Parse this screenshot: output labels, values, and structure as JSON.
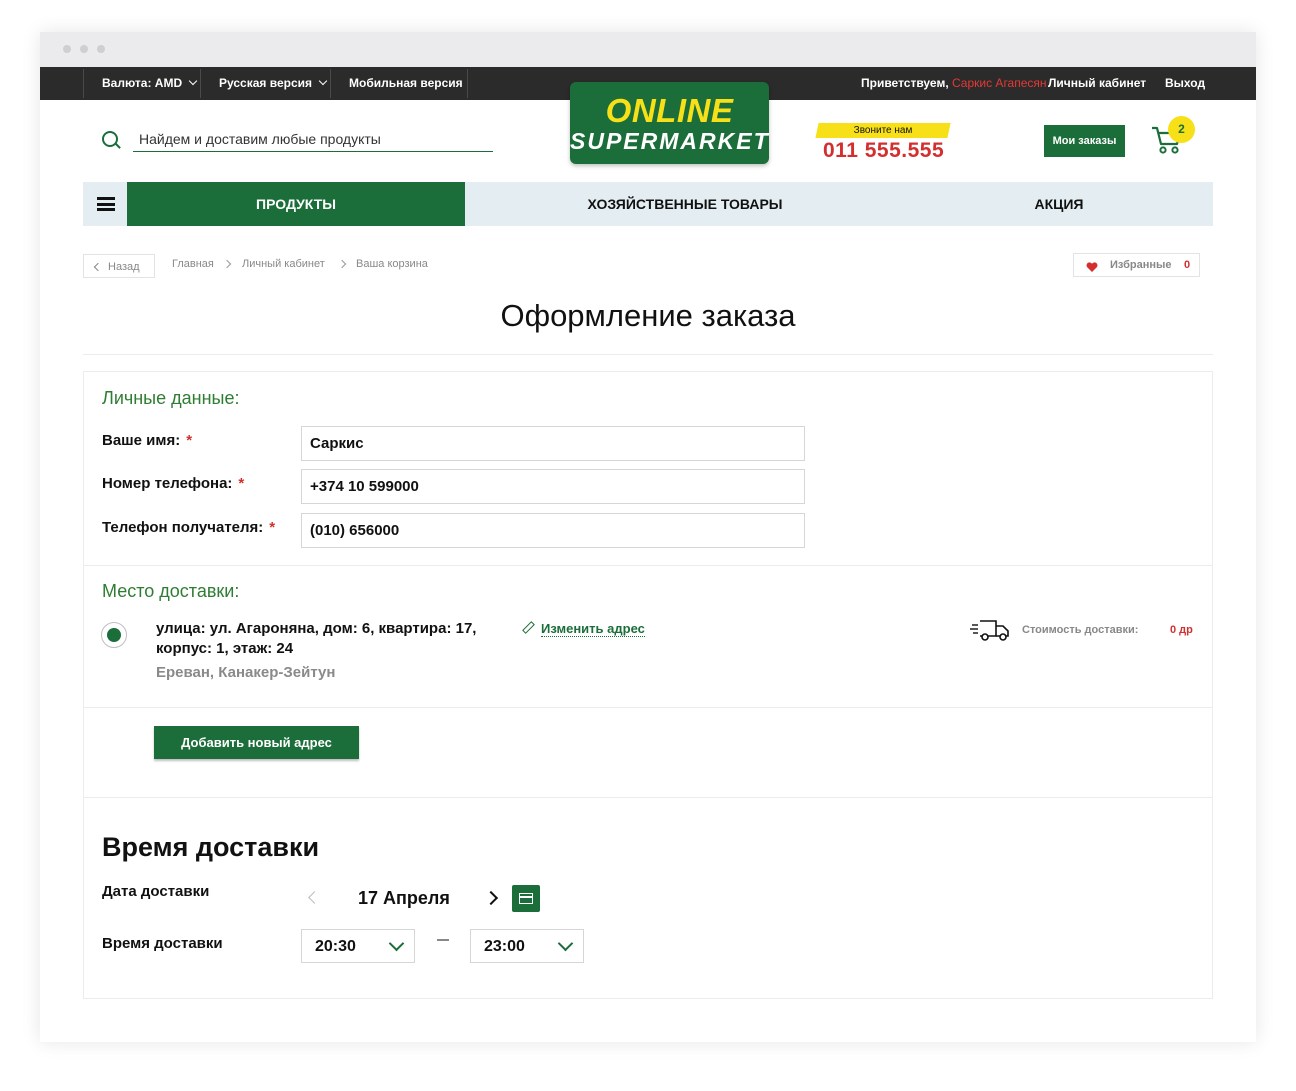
{
  "topbar": {
    "currency": "Валюта: AMD",
    "language": "Русская версия",
    "mobile": "Мобильная версия",
    "greeting": "Приветствуем,",
    "user_name": "Саркис Агапесян",
    "account": "Личный кабинет",
    "logout": "Выход"
  },
  "header": {
    "search_placeholder": "Найдем и доставим любые продукты",
    "logo_line1": "ONLINE",
    "logo_line2": "SUPERMARKET",
    "call_label": "Звоните нам",
    "phone": "011 555.555",
    "orders_label": "Мои заказы",
    "cart_count": "2"
  },
  "nav": {
    "items": [
      {
        "label": "ПРОДУКТЫ"
      },
      {
        "label": "ХОЗЯЙСТВЕННЫЕ ТОВАРЫ"
      },
      {
        "label": "АКЦИЯ"
      }
    ]
  },
  "breadcrumb": {
    "back": "Назад",
    "items": [
      "Главная",
      "Личный кабинет",
      "Ваша корзина"
    ]
  },
  "favorites": {
    "label": "Избранные",
    "count": "0"
  },
  "page_title": "Оформление заказа",
  "personal": {
    "title": "Личные данные:",
    "required_mark": "*",
    "fields": [
      {
        "label": "Ваше имя:",
        "value": "Саркис"
      },
      {
        "label": "Номер телефона:",
        "value": "+374 10 599000"
      },
      {
        "label": "Телефон получателя:",
        "value": "(010) 656000"
      }
    ]
  },
  "delivery_place": {
    "title": "Место доставки:",
    "address_line1": "улица: ул. Агароняна, дом: 6, квартира: 17,",
    "address_line2": "корпус: 1, этаж: 24",
    "city": "Ереван, Канакер-Зейтун",
    "edit_label": "Изменить адрес",
    "cost_label": "Стоимость доставки:",
    "cost_value": "0 др",
    "add_address": "Добавить новый адрес"
  },
  "delivery_time": {
    "title": "Время доставки",
    "date_label": "Дата доставки",
    "date_value": "17 Апреля",
    "time_label": "Время доставки",
    "from": "20:30",
    "to": "23:00"
  },
  "colors": {
    "brand_green": "#1b6e3a",
    "accent_yellow": "#f7e017",
    "accent_red": "#d32f2f",
    "topbar": "#2b2b2b"
  }
}
